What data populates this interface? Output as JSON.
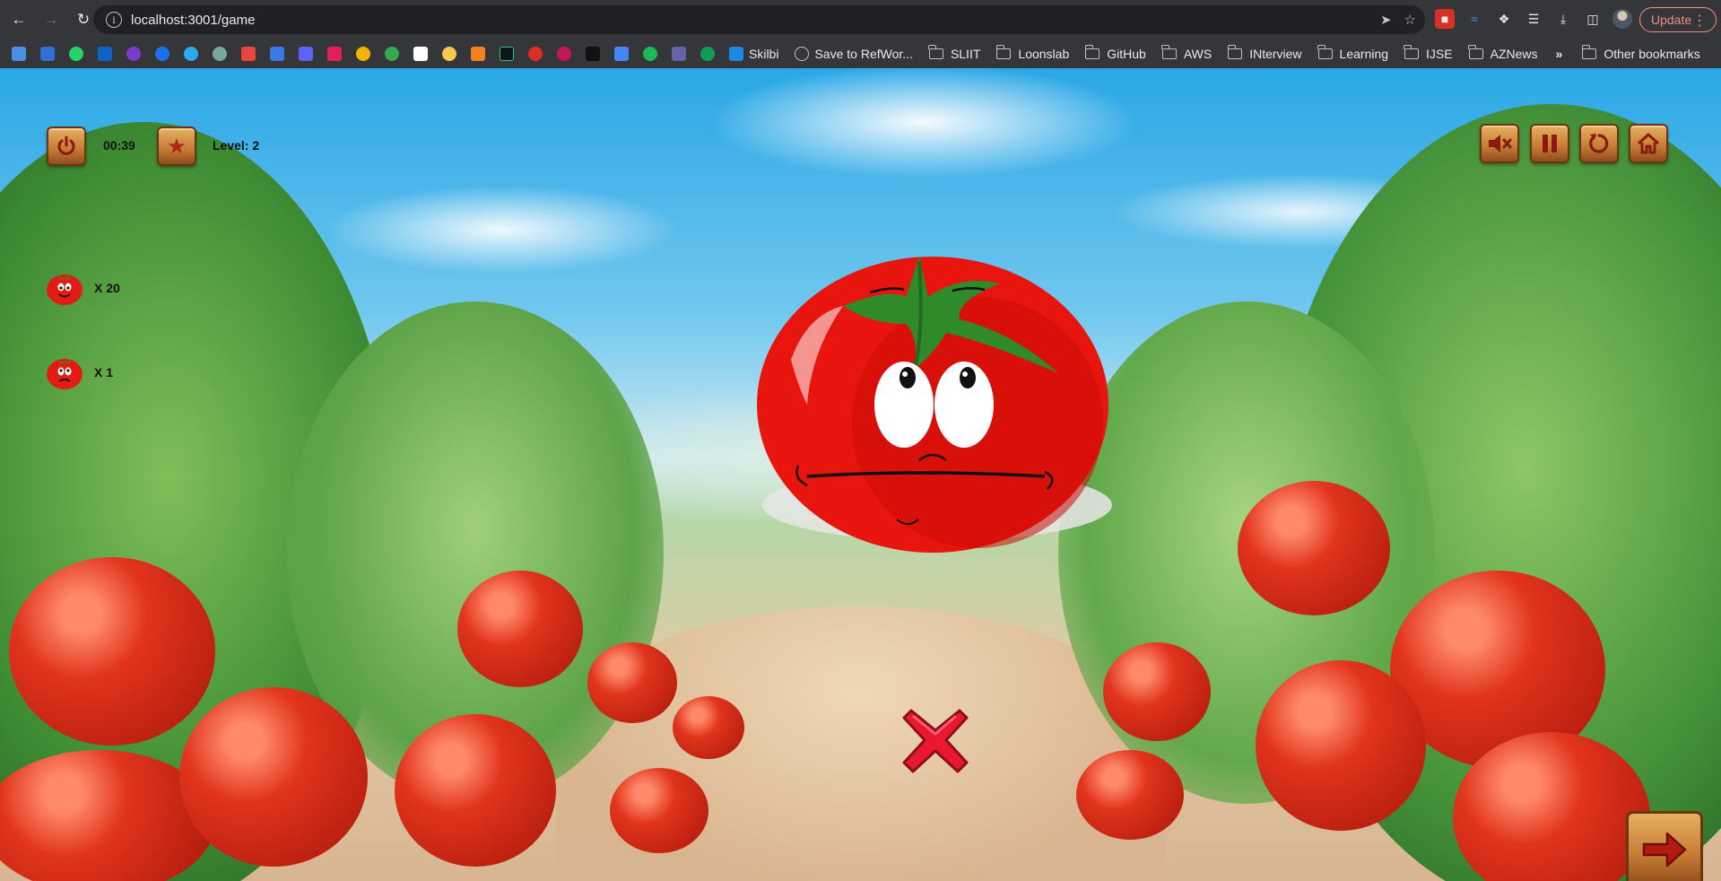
{
  "browser": {
    "url": "localhost:3001/game",
    "update_label": "Update",
    "bookmarks": [
      {
        "label": "Skilbi",
        "icon": "skilbi-icon"
      },
      {
        "label": "Save to RefWor...",
        "icon": "globe-icon"
      },
      {
        "label": "SLIIT",
        "icon": "folder-icon"
      },
      {
        "label": "Loonslab",
        "icon": "folder-icon"
      },
      {
        "label": "GitHub",
        "icon": "folder-icon"
      },
      {
        "label": "AWS",
        "icon": "folder-icon"
      },
      {
        "label": "INterview",
        "icon": "folder-icon"
      },
      {
        "label": "Learning",
        "icon": "folder-icon"
      },
      {
        "label": "IJSE",
        "icon": "folder-icon"
      },
      {
        "label": "AZNews",
        "icon": "folder-icon"
      }
    ],
    "more_bookmarks": "»",
    "other_bookmarks": "Other bookmarks"
  },
  "game": {
    "timer": "00:39",
    "level": "Level: 2",
    "correct_count": "X 20",
    "wrong_count": "X 1",
    "result": "wrong",
    "accent": "#c47a32",
    "tomato_color": "#e81e12"
  }
}
